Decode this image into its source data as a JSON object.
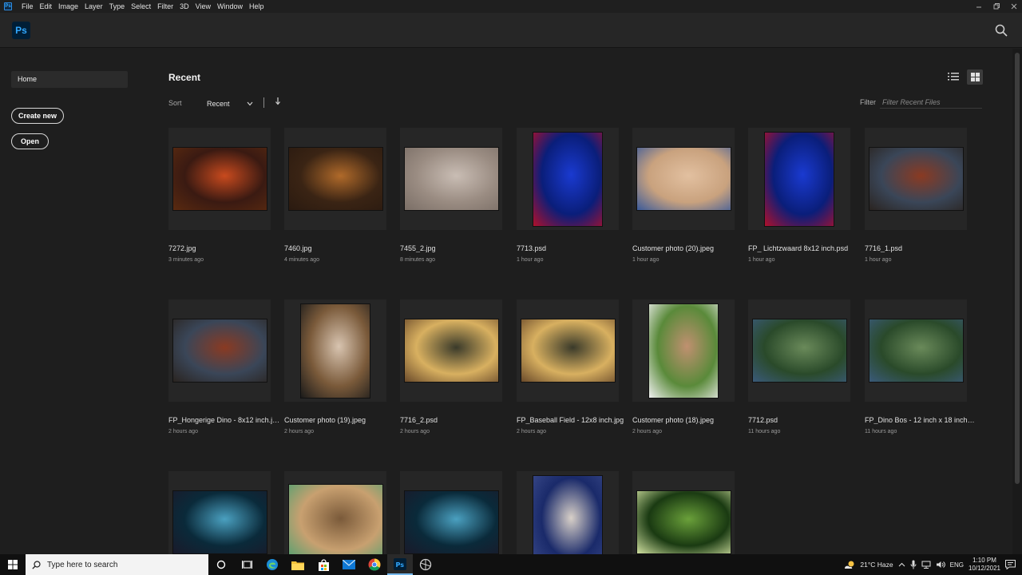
{
  "app": {
    "logo_text": "Ps"
  },
  "menubar": {
    "items": [
      "File",
      "Edit",
      "Image",
      "Layer",
      "Type",
      "Select",
      "Filter",
      "3D",
      "View",
      "Window",
      "Help"
    ]
  },
  "sidebar": {
    "home_label": "Home",
    "create_new_label": "Create new",
    "open_label": "Open"
  },
  "main": {
    "title": "Recent",
    "sort_label": "Sort",
    "sort_value": "Recent",
    "filter_label": "Filter",
    "filter_placeholder": "Filter Recent Files"
  },
  "files": [
    {
      "name": "7272.jpg",
      "time": "3 minutes ago",
      "orientation": "landscape",
      "colors": [
        "#3a1a12",
        "#c84a1e",
        "#5a2a10"
      ]
    },
    {
      "name": "7460.jpg",
      "time": "4 minutes ago",
      "orientation": "landscape",
      "colors": [
        "#3a2414",
        "#b06a2a",
        "#2a1a10"
      ]
    },
    {
      "name": "7455_2.jpg",
      "time": "8 minutes ago",
      "orientation": "landscape",
      "colors": [
        "#9a8c82",
        "#c9bdb4",
        "#7a6e66"
      ]
    },
    {
      "name": "7713.psd",
      "time": "1 hour ago",
      "orientation": "portrait",
      "colors": [
        "#0a1e7a",
        "#1a3ad0",
        "#b0102a"
      ]
    },
    {
      "name": "Customer photo (20).jpeg",
      "time": "1 hour ago",
      "orientation": "landscape",
      "colors": [
        "#c9a27e",
        "#e2c0a0",
        "#3a5a9a"
      ]
    },
    {
      "name": "FP_ Lichtzwaard 8x12 inch.psd",
      "time": "1 hour ago",
      "orientation": "portrait",
      "colors": [
        "#0a1e7a",
        "#1a3ad0",
        "#b0102a"
      ]
    },
    {
      "name": "7716_1.psd",
      "time": "1 hour ago",
      "orientation": "landscape",
      "colors": [
        "#3a4658",
        "#8a3a22",
        "#2a2420"
      ]
    },
    {
      "name": "FP_Hongerige Dino - 8x12 inch.jpg",
      "time": "2 hours ago",
      "orientation": "landscape",
      "colors": [
        "#3a4658",
        "#8a3a22",
        "#2a2420"
      ]
    },
    {
      "name": "Customer photo (19).jpeg",
      "time": "2 hours ago",
      "orientation": "portrait",
      "colors": [
        "#7a5a3a",
        "#d8c4b0",
        "#1a1a1a"
      ]
    },
    {
      "name": "7716_2.psd",
      "time": "2 hours ago",
      "orientation": "landscape",
      "colors": [
        "#d8b060",
        "#3a3a2a",
        "#6a4a2a"
      ]
    },
    {
      "name": "FP_Baseball Field - 12x8 inch.jpg",
      "time": "2 hours ago",
      "orientation": "landscape",
      "colors": [
        "#d8b060",
        "#3a3a2a",
        "#6a4a2a"
      ]
    },
    {
      "name": "Customer photo (18).jpeg",
      "time": "2 hours ago",
      "orientation": "portrait",
      "colors": [
        "#5a8a3a",
        "#c09070",
        "#f0f0f0"
      ]
    },
    {
      "name": "7712.psd",
      "time": "11 hours ago",
      "orientation": "landscape",
      "colors": [
        "#2a4a2a",
        "#6a8a5a",
        "#3a5a7a"
      ]
    },
    {
      "name": "FP_Dino Bos - 12 inch x 18 inch (...",
      "time": "11 hours ago",
      "orientation": "landscape",
      "colors": [
        "#2a4a2a",
        "#6a8a5a",
        "#3a5a7a"
      ]
    },
    {
      "name": "",
      "time": "",
      "orientation": "landscape",
      "colors": [
        "#0a2a3a",
        "#4aa0c0",
        "#1a1a2a"
      ]
    },
    {
      "name": "",
      "time": "",
      "orientation": "square",
      "colors": [
        "#c8a070",
        "#7a5a3a",
        "#50a070"
      ]
    },
    {
      "name": "",
      "time": "",
      "orientation": "landscape",
      "colors": [
        "#0a2a3a",
        "#4aa0c0",
        "#1a1a2a"
      ]
    },
    {
      "name": "",
      "time": "",
      "orientation": "portrait",
      "colors": [
        "#1a2a6a",
        "#d8d0c8",
        "#3a4a8a"
      ]
    },
    {
      "name": "",
      "time": "",
      "orientation": "landscape",
      "colors": [
        "#1a3a12",
        "#6aa03a",
        "#d0e0a0"
      ]
    }
  ],
  "taskbar": {
    "search_placeholder": "Type here to search",
    "weather": "21°C  Haze",
    "time": "1:10 PM",
    "date": "10/12/2021"
  }
}
